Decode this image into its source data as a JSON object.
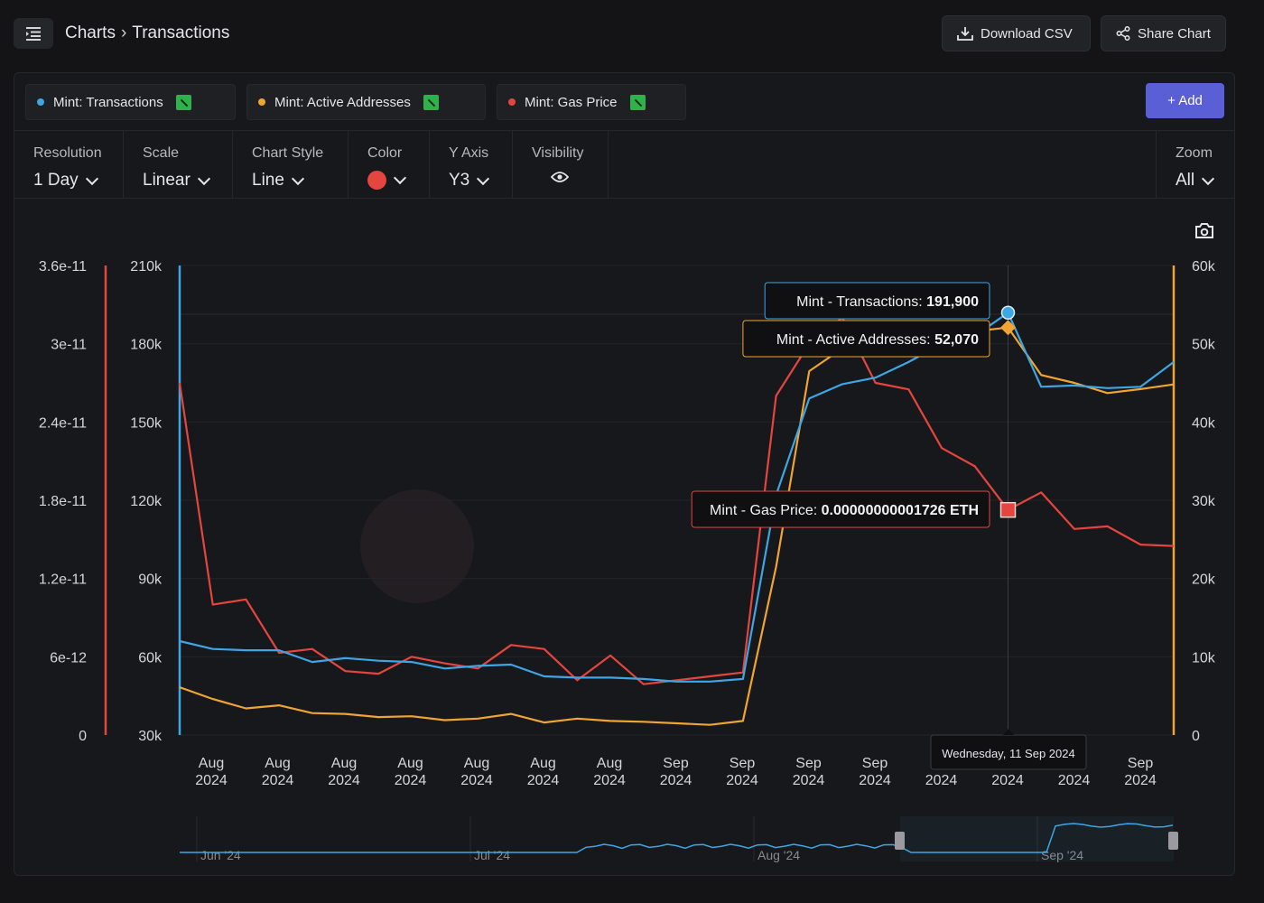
{
  "breadcrumb": {
    "parent": "Charts",
    "separator": "›",
    "current": "Transactions"
  },
  "header_buttons": {
    "download": "Download CSV",
    "share": "Share Chart"
  },
  "series_chips": [
    {
      "label": "Mint: Transactions",
      "color": "#3ea6e5"
    },
    {
      "label": "Mint: Active Addresses",
      "color": "#f0a431"
    },
    {
      "label": "Mint: Gas Price",
      "color": "#e5453f"
    }
  ],
  "add_button": "+ Add",
  "controls": {
    "resolution": {
      "label": "Resolution",
      "value": "1 Day"
    },
    "scale": {
      "label": "Scale",
      "value": "Linear"
    },
    "chart_style": {
      "label": "Chart Style",
      "value": "Line"
    },
    "color": {
      "label": "Color",
      "value": "#e5453f"
    },
    "y_axis": {
      "label": "Y Axis",
      "value": "Y3"
    },
    "visibility": {
      "label": "Visibility"
    },
    "zoom": {
      "label": "Zoom",
      "value": "All"
    }
  },
  "tooltips": {
    "transactions": {
      "label": "Mint - Transactions:",
      "value": "191,900"
    },
    "active_addresses": {
      "label": "Mint - Active Addresses:",
      "value": "52,070"
    },
    "gas_price": {
      "label": "Mint - Gas Price:",
      "value": "0.00000000001726 ETH"
    },
    "date": "Wednesday, 11 Sep 2024"
  },
  "chart_data": {
    "type": "line",
    "x_labels": [
      [
        "Aug",
        "2024"
      ],
      [
        "Aug",
        "2024"
      ],
      [
        "Aug",
        "2024"
      ],
      [
        "Aug",
        "2024"
      ],
      [
        "Aug",
        "2024"
      ],
      [
        "Aug",
        "2024"
      ],
      [
        "Aug",
        "2024"
      ],
      [
        "Sep",
        "2024"
      ],
      [
        "Sep",
        "2024"
      ],
      [
        "Sep",
        "2024"
      ],
      [
        "Sep",
        "2024"
      ],
      [
        "",
        "2024"
      ],
      [
        "",
        "2024"
      ],
      [
        "",
        "2024"
      ],
      [
        "Sep",
        "2024"
      ]
    ],
    "y_axes": [
      {
        "side": "left-outer",
        "ticks": [
          "3.6e-11",
          "3e-11",
          "2.4e-11",
          "1.8e-11",
          "1.2e-11",
          "6e-12",
          "0"
        ],
        "range": [
          0,
          3.6e-11
        ],
        "color": "#e5453f"
      },
      {
        "side": "left-inner",
        "ticks": [
          "210k",
          "180k",
          "150k",
          "120k",
          "90k",
          "60k",
          "30k"
        ],
        "range": [
          30000,
          210000
        ],
        "color": "#3ea6e5"
      },
      {
        "side": "right",
        "ticks": [
          "60k",
          "50k",
          "40k",
          "30k",
          "20k",
          "10k",
          "0"
        ],
        "range": [
          0,
          60000
        ],
        "color": "#f0a431"
      }
    ],
    "series": [
      {
        "name": "Mint: Transactions",
        "axis": 1,
        "color": "#3ea6e5",
        "values": [
          66000,
          63000,
          62500,
          62500,
          58000,
          59500,
          58500,
          58000,
          55500,
          56500,
          57000,
          52500,
          52000,
          52000,
          51500,
          50500,
          50500,
          51500,
          122000,
          159000,
          164500,
          167000,
          173000,
          180000,
          183000,
          191900,
          163500,
          164000,
          163000,
          163500,
          173000
        ]
      },
      {
        "name": "Mint: Active Addresses",
        "axis": 2,
        "color": "#f0a431",
        "values": [
          6100,
          4600,
          3400,
          3800,
          2800,
          2700,
          2300,
          2400,
          1900,
          2100,
          2700,
          1600,
          2100,
          1800,
          1700,
          1500,
          1300,
          1800,
          21500,
          46500,
          49400,
          49700,
          51500,
          50800,
          51600,
          52070,
          46000,
          45000,
          43700,
          44200,
          44800
        ]
      },
      {
        "name": "Mint: Gas Price",
        "axis": 0,
        "color": "#e5453f",
        "values": [
          2.7e-11,
          1e-11,
          1.04e-11,
          6.3e-12,
          6.6e-12,
          4.9e-12,
          4.7e-12,
          6e-12,
          5.5e-12,
          5.1e-12,
          6.9e-12,
          6.6e-12,
          4.2e-12,
          6.1e-12,
          3.9e-12,
          4.2e-12,
          4.5e-12,
          4.8e-12,
          2.6e-11,
          3e-11,
          3.2e-11,
          2.7e-11,
          2.65e-11,
          2.2e-11,
          2.06e-11,
          1.726e-11,
          1.86e-11,
          1.58e-11,
          1.6e-11,
          1.46e-11,
          1.45e-11
        ]
      }
    ],
    "highlight_index": 25,
    "grid": true,
    "navigator_labels": [
      "Jun '24",
      "Jul '24",
      "Aug '24",
      "Sep '24"
    ]
  }
}
